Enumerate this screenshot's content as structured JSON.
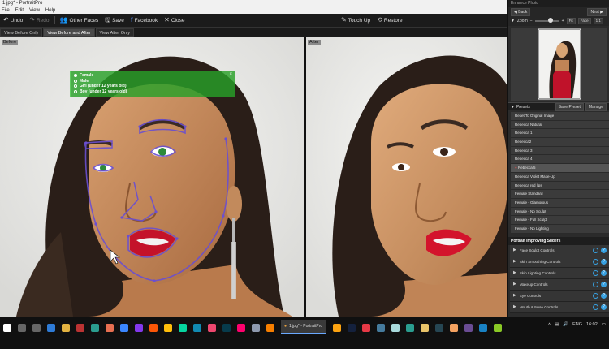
{
  "window": {
    "title": "1.jpg* - PortraitPro"
  },
  "menu": [
    "File",
    "Edit",
    "View",
    "Help"
  ],
  "toolbar": {
    "undo": "Undo",
    "redo": "Redo",
    "other_faces": "Other Faces",
    "save": "Save",
    "facebook": "Facebook",
    "close": "Close",
    "touch_up": "Touch Up",
    "restore": "Restore"
  },
  "view_tabs": [
    "View Before Only",
    "View Before and After",
    "View After Only"
  ],
  "active_view_tab": "View Before and After",
  "panes": {
    "before_label": "Before",
    "after_label": "After"
  },
  "gender_popup": {
    "options": [
      "Female",
      "Male",
      "Girl (under 12 years old)",
      "Boy (under 12 years old)"
    ],
    "selected": "Female"
  },
  "right_panel": {
    "title": "Enhance Photo",
    "back": "Back",
    "next": "Next",
    "zoom_label": "Zoom",
    "zoom_buttons": [
      "Fit",
      "Face",
      "1:1"
    ],
    "presets_label": "Presets",
    "save_preset": "Save Preset",
    "manage": "Manage",
    "presets": [
      "Reset To Original Image",
      "Rebecca Natural",
      "Rebecca 1",
      "Rebecca2",
      "Rebecca 3",
      "Rebecca 4",
      "Rebecca 5",
      "Rebecca Violet Make-Up",
      "Rebecca red lips",
      "Female Standard",
      "Female - Glamorous",
      "Female - No Sculpt",
      "Female - Full Sculpt",
      "Female - No Lighting"
    ],
    "selected_preset": "Rebecca 5",
    "sliders_heading": "Portrait Improving Sliders",
    "controls": [
      "Face Sculpt Controls",
      "Skin Smoothing Controls",
      "Skin Lighting Controls",
      "Makeup Controls",
      "Eye Controls",
      "Mouth & Nose Controls"
    ]
  },
  "taskbar": {
    "active_app": "1.jpg* - PortraitPro",
    "lang": "ENG",
    "time": "16:02"
  },
  "colors": {
    "accent_blue": "#37a0e0",
    "gender_green": "#28a028",
    "outline_purple": "#6a4fd0"
  }
}
